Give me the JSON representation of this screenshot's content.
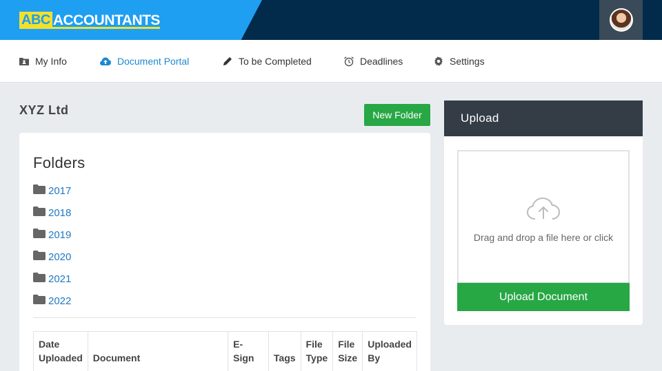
{
  "header": {
    "logo_abc": "ABC",
    "logo_rest": "ACCOUNTANTS"
  },
  "nav": {
    "items": [
      {
        "label": "My Info",
        "icon": "id-card-icon"
      },
      {
        "label": "Document Portal",
        "icon": "cloud-upload-icon",
        "active": true
      },
      {
        "label": "To be Completed",
        "icon": "pencil-icon"
      },
      {
        "label": "Deadlines",
        "icon": "alarm-clock-icon"
      },
      {
        "label": "Settings",
        "icon": "gear-icon"
      }
    ]
  },
  "main": {
    "company_name": "XYZ Ltd",
    "new_folder_label": "New Folder",
    "folders_title": "Folders",
    "folders": [
      "2017",
      "2018",
      "2019",
      "2020",
      "2021",
      "2022"
    ],
    "table_columns": [
      "Date Uploaded",
      "Document",
      "E-Sign",
      "Tags",
      "File Type",
      "File Size",
      "Uploaded By"
    ]
  },
  "upload": {
    "title": "Upload",
    "dropzone_text": "Drag and drop a file here or click",
    "button_label": "Upload Document"
  },
  "colors": {
    "brand_blue": "#1e9ff2",
    "navy": "#022b4b",
    "accent_yellow": "#f4e02a",
    "primary_green": "#28a745",
    "link_blue": "#1e78c2"
  }
}
